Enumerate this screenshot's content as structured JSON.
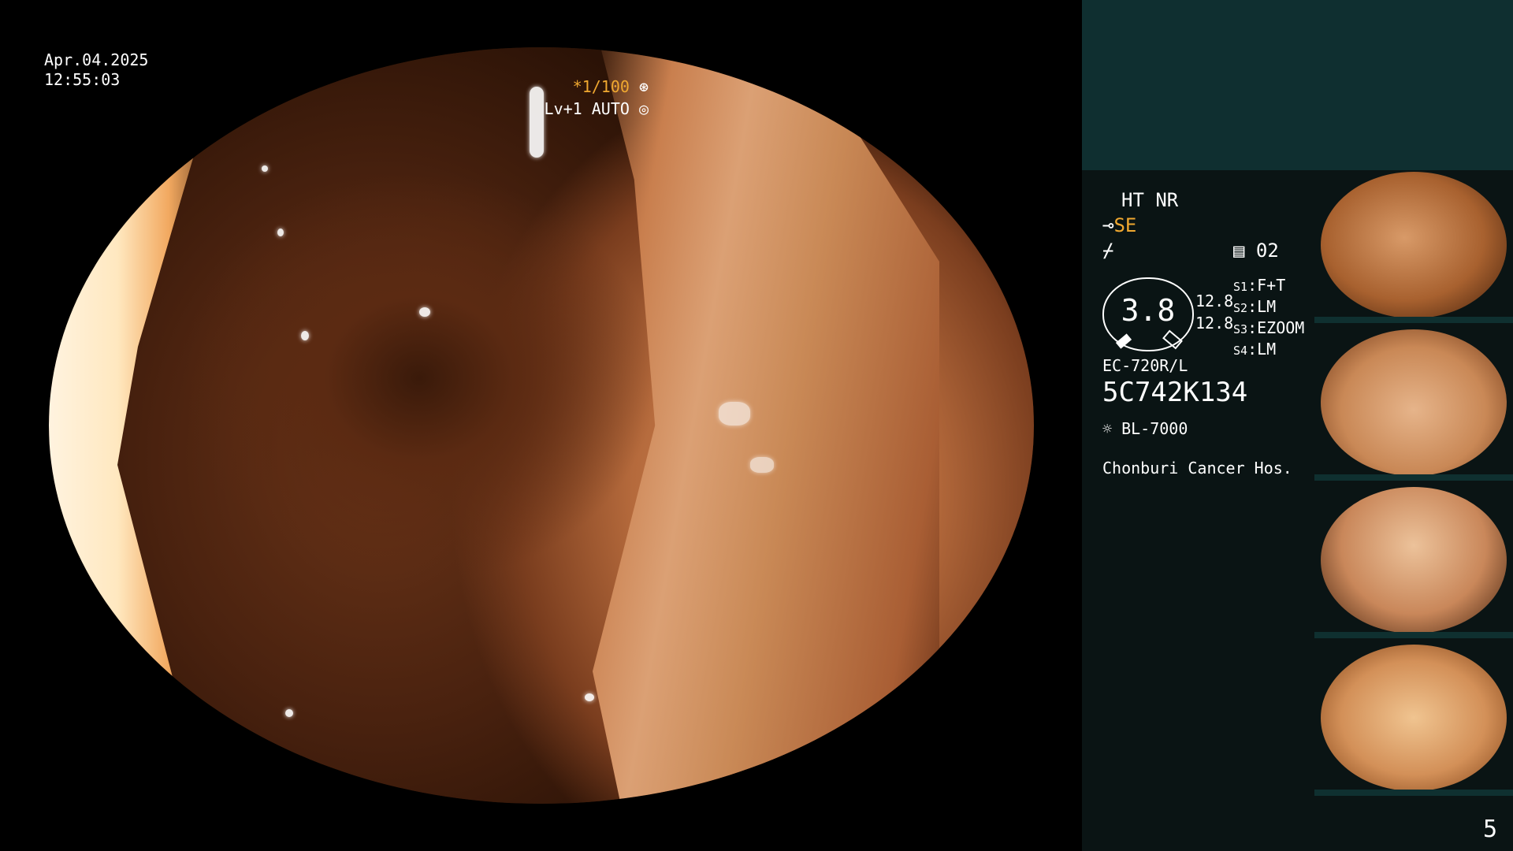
{
  "overlay": {
    "date": "Apr.04.2025",
    "time": "12:55:03",
    "shutter": "*1/100",
    "exposure": "Lv+1 AUTO"
  },
  "panel": {
    "mode": "HT NR",
    "enhance": "SE",
    "memory": "02",
    "zoom_value": "3.8",
    "left_values": [
      "12.8",
      "12.8"
    ],
    "switch_labels": [
      {
        "key": "S1",
        "value": "F+T"
      },
      {
        "key": "S2",
        "value": "LM"
      },
      {
        "key": "S3",
        "value": "EZOOM"
      },
      {
        "key": "S4",
        "value": "LM"
      }
    ],
    "scope_model": "EC-720R/L",
    "serial": "5C742K134",
    "light_source": "BL-7000",
    "hospital": "Chonburi Cancer Hos.",
    "page_number": "5"
  },
  "thumbnails": [
    {
      "label": "thumbnail-1"
    },
    {
      "label": "thumbnail-2"
    },
    {
      "label": "thumbnail-3"
    },
    {
      "label": "thumbnail-4"
    }
  ]
}
